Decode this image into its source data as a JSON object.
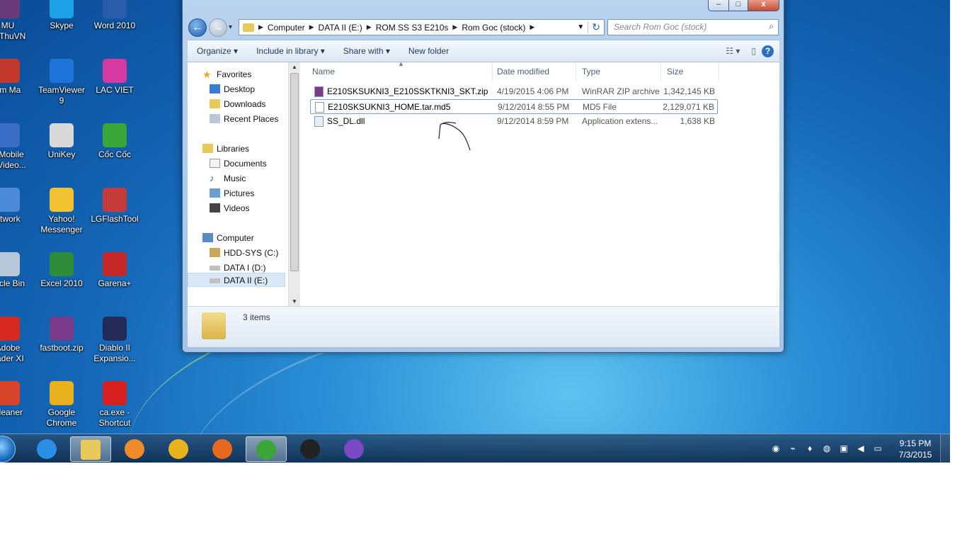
{
  "desktop_icons": [
    {
      "label": "MU",
      "label2": "heThuVN",
      "color": "#6a3b7a"
    },
    {
      "label": "Skype",
      "label2": "",
      "color": "#1da1e6"
    },
    {
      "label": "Word 2010",
      "label2": "",
      "color": "#2b5cab"
    },
    {
      "label": "ếm Ma",
      "label2": "",
      "color": "#c0392b"
    },
    {
      "label": "TeamViewer",
      "label2": "9",
      "color": "#1e73d8"
    },
    {
      "label": "LAC VIET",
      "label2": "",
      "color": "#d63aa0"
    },
    {
      "label": "a Mobile",
      "label2": "P Video...",
      "color": "#3a6ec6"
    },
    {
      "label": "UniKey",
      "label2": "",
      "color": "#d9d9d9"
    },
    {
      "label": "Cốc Cốc",
      "label2": "",
      "color": "#3aa63a"
    },
    {
      "label": "etwork",
      "label2": "",
      "color": "#4a8ad6"
    },
    {
      "label": "Yahoo!",
      "label2": "Messenger",
      "color": "#f2c230"
    },
    {
      "label": "LGFlashTool",
      "label2": "",
      "color": "#c63a3a"
    },
    {
      "label": "cycle Bin",
      "label2": "",
      "color": "#b8c8d8"
    },
    {
      "label": "Excel 2010",
      "label2": "",
      "color": "#2e8b3a"
    },
    {
      "label": "Garena+",
      "label2": "",
      "color": "#c62828"
    },
    {
      "label": "Adobe",
      "label2": "eader XI",
      "color": "#d62a1e"
    },
    {
      "label": "fastboot.zip",
      "label2": "",
      "color": "#7a3a8a"
    },
    {
      "label": "Diablo II",
      "label2": "Expansio...",
      "color": "#222a55"
    },
    {
      "label": "Cleaner",
      "label2": "",
      "color": "#d6452a"
    },
    {
      "label": "Google",
      "label2": "Chrome",
      "color": "#e8b21e"
    },
    {
      "label": "ca.exe -",
      "label2": "Shortcut",
      "color": "#d62020"
    }
  ],
  "window": {
    "caption_buttons": {
      "minimize": "–",
      "maximize": "□",
      "close": "x"
    },
    "nav": {
      "back": "←",
      "forward": "→",
      "dropdown": "▾"
    },
    "breadcrumb": [
      "Computer",
      "DATA II (E:)",
      "ROM SS S3 E210s",
      "Rom Goc (stock)"
    ],
    "refresh": "↻",
    "search_placeholder": "Search Rom Goc (stock)",
    "toolbar": {
      "organize": "Organize",
      "include": "Include in library",
      "share": "Share with",
      "newfolder": "New folder"
    },
    "nav_pane": {
      "favorites": {
        "header": "Favorites",
        "items": [
          "Desktop",
          "Downloads",
          "Recent Places"
        ]
      },
      "libraries": {
        "header": "Libraries",
        "items": [
          "Documents",
          "Music",
          "Pictures",
          "Videos"
        ]
      },
      "computer": {
        "header": "Computer",
        "items": [
          "HDD-SYS (C:)",
          "DATA I (D:)",
          "DATA II (E:)"
        ],
        "selected": "DATA II (E:)"
      }
    },
    "columns": {
      "name": "Name",
      "date": "Date modified",
      "type": "Type",
      "size": "Size"
    },
    "files": [
      {
        "name": "E210SKSUKNI3_E210SSKTKNI3_SKT.zip",
        "date": "4/19/2015 4:06 PM",
        "type": "WinRAR ZIP archive",
        "size": "1,342,145 KB",
        "icon_color": "#7a3a8a"
      },
      {
        "name": "E210SKSUKNI3_HOME.tar.md5",
        "date": "9/12/2014 8:55 PM",
        "type": "MD5 File",
        "size": "2,129,071 KB",
        "icon_color": "#ffffff"
      },
      {
        "name": "SS_DL.dll",
        "date": "9/12/2014 8:59 PM",
        "type": "Application extens...",
        "size": "1,638 KB",
        "icon_color": "#e8eef6"
      }
    ],
    "selected_file": "E210SKSUKNI3_HOME.tar.md5",
    "status": "3 items"
  },
  "taskbar": {
    "start": "start-orb",
    "apps": [
      {
        "name": "internet-explorer",
        "color": "#2b8ee6",
        "active": false
      },
      {
        "name": "windows-explorer",
        "color": "#e8c95a",
        "active": true
      },
      {
        "name": "media-player",
        "color": "#f08a2a",
        "active": false
      },
      {
        "name": "chrome",
        "color": "#e8b21e",
        "active": false
      },
      {
        "name": "firefox",
        "color": "#e8691e",
        "active": false
      },
      {
        "name": "coccoc",
        "color": "#3aa63a",
        "active": true
      },
      {
        "name": "mu-game",
        "color": "#222",
        "active": false
      },
      {
        "name": "viber",
        "color": "#7a4ac6",
        "active": false
      }
    ],
    "tray": [
      "viber-tray",
      "network-tray",
      "garena-tray",
      "tray-app",
      "monitor-tray",
      "volume-tray",
      "action-center-tray"
    ],
    "time": "9:15 PM",
    "date": "7/3/2015"
  },
  "colors": {
    "accent": "#1e395b",
    "selection": "#cce8ff",
    "selection_border": "#7da2ce"
  }
}
